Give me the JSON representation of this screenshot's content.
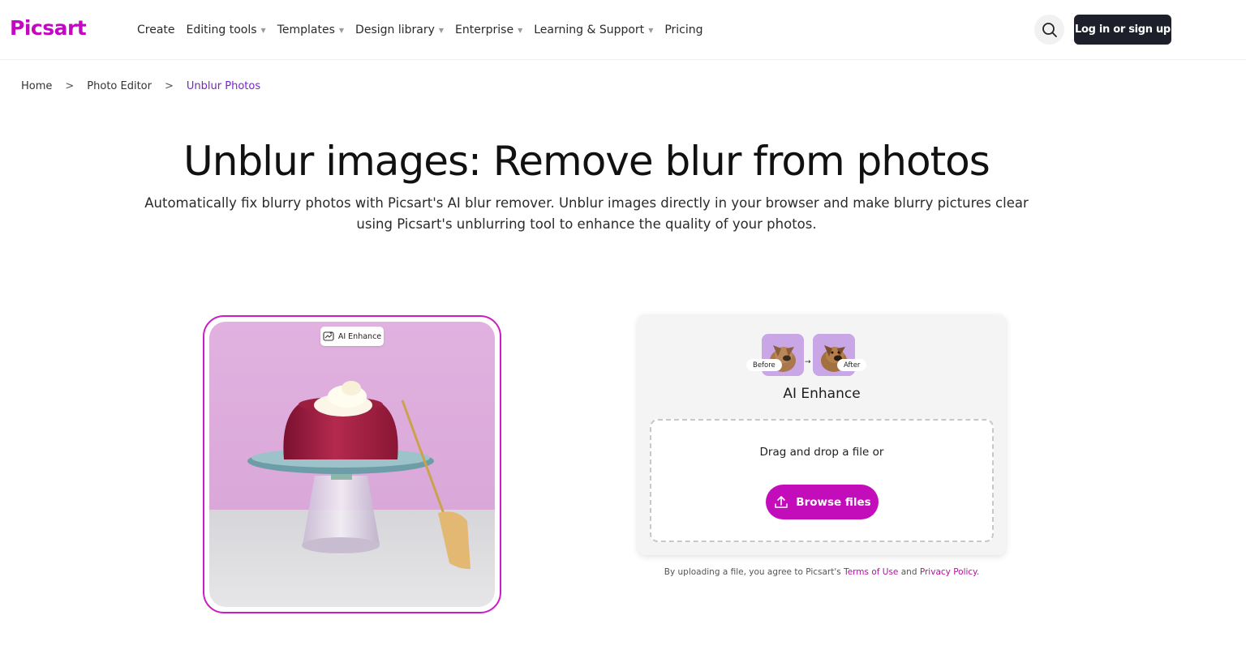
{
  "brand": {
    "logo": "Picsart",
    "accent": "#c209c1",
    "dark": "#1d1f2a"
  },
  "nav": {
    "items": [
      {
        "label": "Create",
        "has_caret": false
      },
      {
        "label": "Editing tools",
        "has_caret": true
      },
      {
        "label": "Templates",
        "has_caret": true
      },
      {
        "label": "Design library",
        "has_caret": true
      },
      {
        "label": "Enterprise",
        "has_caret": true
      },
      {
        "label": "Learning & Support",
        "has_caret": true
      },
      {
        "label": "Pricing",
        "has_caret": false
      }
    ],
    "search_icon": "search-icon",
    "login_label": "Log in or sign up"
  },
  "breadcrumb": {
    "items": [
      "Home",
      "Photo Editor",
      "Unblur Photos"
    ]
  },
  "hero": {
    "title": "Unblur images: Remove blur from photos",
    "subtitle": "Automatically fix blurry photos with Picsart's AI blur remover. Unblur images directly in your browser and make blurry pictures clear using Picsart's unblurring tool to enhance the quality of your photos."
  },
  "preview": {
    "badge_label": "AI Enhance",
    "badge_icon": "enhance-icon"
  },
  "upload_card": {
    "before_label": "Before",
    "after_label": "After",
    "title": "AI Enhance",
    "drop_text": "Drag and drop a file or",
    "browse_label": "Browse files",
    "browse_icon": "upload-icon"
  },
  "terms": {
    "prefix": "By uploading a file, you agree to Picsart's ",
    "terms_link": "Terms of Use",
    "middle": " and ",
    "privacy_link": "Privacy Policy."
  }
}
